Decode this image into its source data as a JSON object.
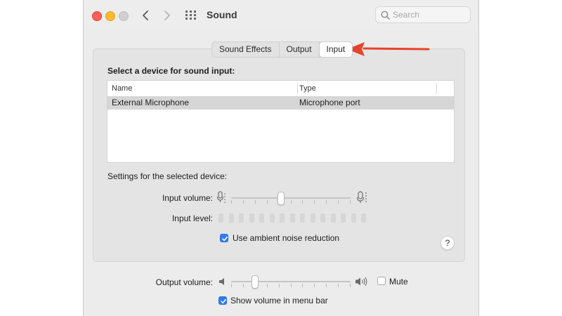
{
  "window": {
    "title": "Sound"
  },
  "search": {
    "placeholder": "Search"
  },
  "tabs": [
    {
      "label": "Sound Effects",
      "active": false
    },
    {
      "label": "Output",
      "active": false
    },
    {
      "label": "Input",
      "active": true
    }
  ],
  "input_panel": {
    "heading": "Select a device for sound input:",
    "columns": {
      "name": "Name",
      "type": "Type"
    },
    "devices": [
      {
        "name": "External Microphone",
        "type": "Microphone port",
        "selected": true
      }
    ],
    "settings_label": "Settings for the selected device:",
    "input_volume_label": "Input volume:",
    "input_volume_fraction": 0.42,
    "input_level_label": "Input level:",
    "input_level_segments": 15,
    "input_level_active": 0,
    "noise_reduction_label": "Use ambient noise reduction",
    "noise_reduction_checked": true,
    "help": "?"
  },
  "bottom": {
    "output_volume_label": "Output volume:",
    "output_volume_fraction": 0.2,
    "mute_label": "Mute",
    "mute_checked": false,
    "menu_bar_label": "Show volume in menu bar",
    "menu_bar_checked": true
  },
  "colors": {
    "accent": "#2e7cf6",
    "annotation_arrow": "#e8432c"
  },
  "icons": [
    "close-button",
    "minimize-button",
    "zoom-button",
    "back-chevron-icon",
    "forward-chevron-icon",
    "grid-icon",
    "search-icon",
    "microphone-icon",
    "speaker-icon",
    "help-icon"
  ]
}
